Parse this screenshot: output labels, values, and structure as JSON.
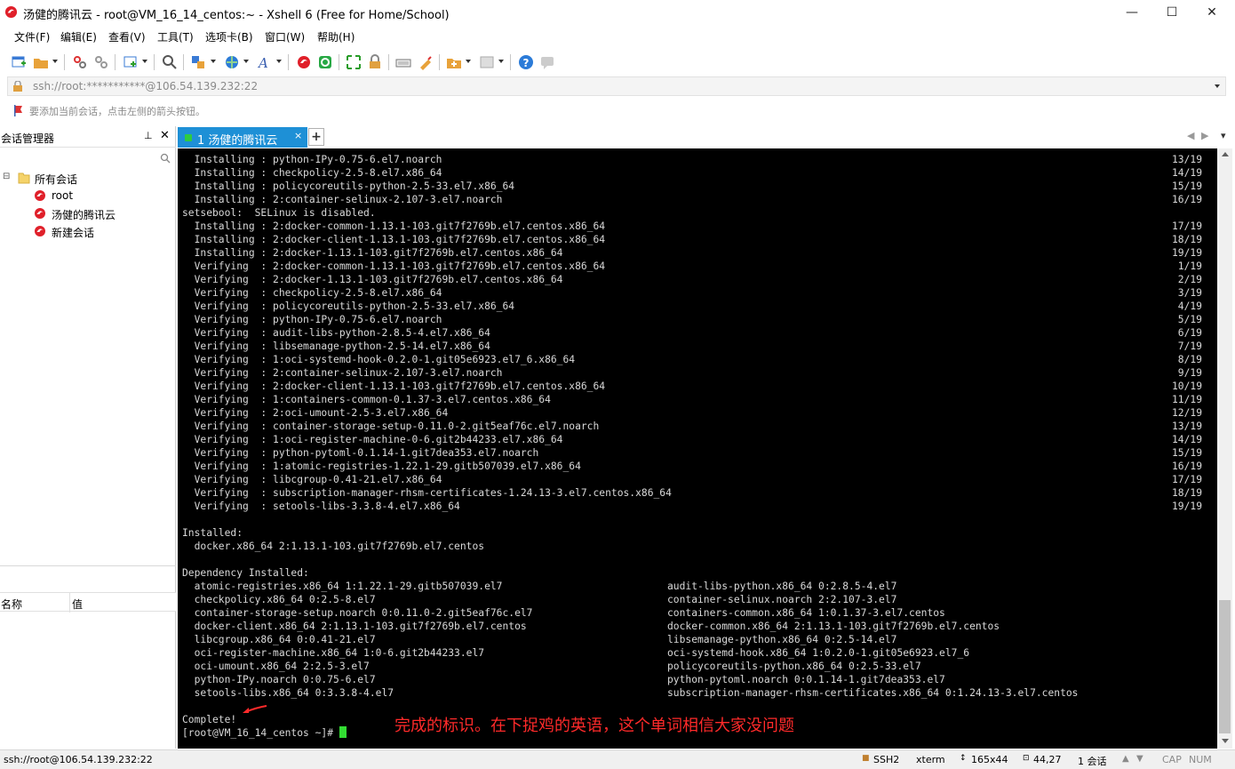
{
  "window": {
    "title": "汤健的腾讯云 - root@VM_16_14_centos:~ - Xshell 6 (Free for Home/School)",
    "minimize": "—",
    "maximize": "☐",
    "close": "✕"
  },
  "menu": [
    "文件(F)",
    "编辑(E)",
    "查看(V)",
    "工具(T)",
    "选项卡(B)",
    "窗口(W)",
    "帮助(H)"
  ],
  "address": {
    "text": "ssh://root:***********@106.54.139.232:22"
  },
  "hint": {
    "text": "要添加当前会话，点击左侧的箭头按钮。"
  },
  "session_manager": {
    "title": "会话管理器",
    "pin": "ᵠ",
    "close": "✕",
    "tree": {
      "root_label": "所有会话",
      "items": [
        "root",
        "汤健的腾讯云",
        "新建会话"
      ]
    },
    "properties": {
      "col_name": "名称",
      "col_value": "值"
    }
  },
  "tabs": {
    "active_label": "1 汤健的腾讯云",
    "close": "×",
    "new": "+",
    "nav_left": "◀",
    "nav_right": "▶",
    "nav_menu": "▾"
  },
  "terminal": {
    "progress_lines": [
      {
        "text": "  Installing : python-IPy-0.75-6.el7.noarch",
        "progress": "13/19"
      },
      {
        "text": "  Installing : checkpolicy-2.5-8.el7.x86_64",
        "progress": "14/19"
      },
      {
        "text": "  Installing : policycoreutils-python-2.5-33.el7.x86_64",
        "progress": "15/19"
      },
      {
        "text": "  Installing : 2:container-selinux-2.107-3.el7.noarch",
        "progress": "16/19"
      },
      {
        "text": "setsebool:  SELinux is disabled.",
        "progress": ""
      },
      {
        "text": "  Installing : 2:docker-common-1.13.1-103.git7f2769b.el7.centos.x86_64",
        "progress": "17/19"
      },
      {
        "text": "  Installing : 2:docker-client-1.13.1-103.git7f2769b.el7.centos.x86_64",
        "progress": "18/19"
      },
      {
        "text": "  Installing : 2:docker-1.13.1-103.git7f2769b.el7.centos.x86_64",
        "progress": "19/19"
      },
      {
        "text": "  Verifying  : 2:docker-common-1.13.1-103.git7f2769b.el7.centos.x86_64",
        "progress": "1/19"
      },
      {
        "text": "  Verifying  : 2:docker-1.13.1-103.git7f2769b.el7.centos.x86_64",
        "progress": "2/19"
      },
      {
        "text": "  Verifying  : checkpolicy-2.5-8.el7.x86_64",
        "progress": "3/19"
      },
      {
        "text": "  Verifying  : policycoreutils-python-2.5-33.el7.x86_64",
        "progress": "4/19"
      },
      {
        "text": "  Verifying  : python-IPy-0.75-6.el7.noarch",
        "progress": "5/19"
      },
      {
        "text": "  Verifying  : audit-libs-python-2.8.5-4.el7.x86_64",
        "progress": "6/19"
      },
      {
        "text": "  Verifying  : libsemanage-python-2.5-14.el7.x86_64",
        "progress": "7/19"
      },
      {
        "text": "  Verifying  : 1:oci-systemd-hook-0.2.0-1.git05e6923.el7_6.x86_64",
        "progress": "8/19"
      },
      {
        "text": "  Verifying  : 2:container-selinux-2.107-3.el7.noarch",
        "progress": "9/19"
      },
      {
        "text": "  Verifying  : 2:docker-client-1.13.1-103.git7f2769b.el7.centos.x86_64",
        "progress": "10/19"
      },
      {
        "text": "  Verifying  : 1:containers-common-0.1.37-3.el7.centos.x86_64",
        "progress": "11/19"
      },
      {
        "text": "  Verifying  : 2:oci-umount-2.5-3.el7.x86_64",
        "progress": "12/19"
      },
      {
        "text": "  Verifying  : container-storage-setup-0.11.0-2.git5eaf76c.el7.noarch",
        "progress": "13/19"
      },
      {
        "text": "  Verifying  : 1:oci-register-machine-0-6.git2b44233.el7.x86_64",
        "progress": "14/19"
      },
      {
        "text": "  Verifying  : python-pytoml-0.1.14-1.git7dea353.el7.noarch",
        "progress": "15/19"
      },
      {
        "text": "  Verifying  : 1:atomic-registries-1.22.1-29.gitb507039.el7.x86_64",
        "progress": "16/19"
      },
      {
        "text": "  Verifying  : libcgroup-0.41-21.el7.x86_64",
        "progress": "17/19"
      },
      {
        "text": "  Verifying  : subscription-manager-rhsm-certificates-1.24.13-3.el7.centos.x86_64",
        "progress": "18/19"
      },
      {
        "text": "  Verifying  : setools-libs-3.3.8-4.el7.x86_64",
        "progress": "19/19"
      }
    ],
    "installed_header": "Installed:",
    "installed_item": "  docker.x86_64 2:1.13.1-103.git7f2769b.el7.centos",
    "dep_header": "Dependency Installed:",
    "dep_rows": [
      [
        "  atomic-registries.x86_64 1:1.22.1-29.gitb507039.el7",
        "audit-libs-python.x86_64 0:2.8.5-4.el7"
      ],
      [
        "  checkpolicy.x86_64 0:2.5-8.el7",
        "container-selinux.noarch 2:2.107-3.el7"
      ],
      [
        "  container-storage-setup.noarch 0:0.11.0-2.git5eaf76c.el7",
        "containers-common.x86_64 1:0.1.37-3.el7.centos"
      ],
      [
        "  docker-client.x86_64 2:1.13.1-103.git7f2769b.el7.centos",
        "docker-common.x86_64 2:1.13.1-103.git7f2769b.el7.centos"
      ],
      [
        "  libcgroup.x86_64 0:0.41-21.el7",
        "libsemanage-python.x86_64 0:2.5-14.el7"
      ],
      [
        "  oci-register-machine.x86_64 1:0-6.git2b44233.el7",
        "oci-systemd-hook.x86_64 1:0.2.0-1.git05e6923.el7_6"
      ],
      [
        "  oci-umount.x86_64 2:2.5-3.el7",
        "policycoreutils-python.x86_64 0:2.5-33.el7"
      ],
      [
        "  python-IPy.noarch 0:0.75-6.el7",
        "python-pytoml.noarch 0:0.1.14-1.git7dea353.el7"
      ],
      [
        "  setools-libs.x86_64 0:3.3.8-4.el7",
        "subscription-manager-rhsm-certificates.x86_64 0:1.24.13-3.el7.centos"
      ]
    ],
    "complete": "Complete!",
    "prompt": "[root@VM_16_14_centos ~]# ",
    "annotation": "完成的标识。在下捉鸡的英语，这个单词相信大家没问题",
    "annotation_color": "#ff2a2a",
    "cursor_color": "#33dd33"
  },
  "status": {
    "connection": "ssh://root@106.54.139.232:22",
    "protocol": "SSH2",
    "terminal_type": "xterm",
    "size": "165x44",
    "position": "44,27",
    "sessions": "1 会话",
    "cap": "CAP",
    "num": "NUM"
  },
  "colors": {
    "tab_active": "#1e90d6",
    "terminal_bg": "#000000",
    "terminal_fg": "#d9d9d9"
  }
}
